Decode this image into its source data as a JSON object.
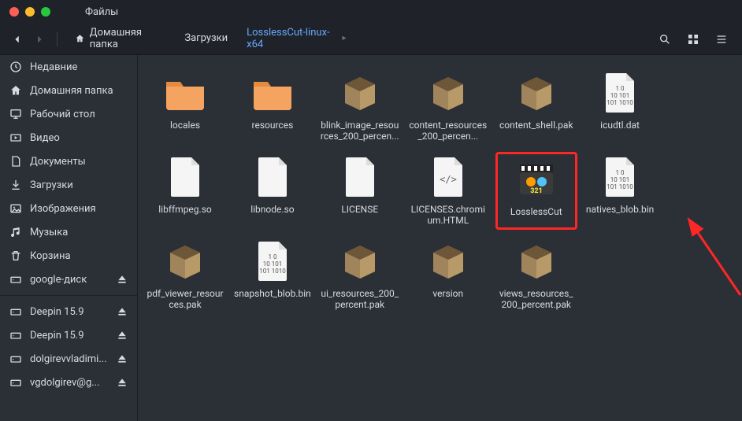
{
  "window": {
    "title": "Файлы"
  },
  "breadcrumb": {
    "home": "Домашняя папка",
    "downloads": "Загрузки",
    "current": "LosslessCut-linux-x64"
  },
  "sidebar": {
    "items": [
      {
        "icon": "clock-icon",
        "label": "Недавние"
      },
      {
        "icon": "home-icon",
        "label": "Домашняя папка"
      },
      {
        "icon": "desktop-icon",
        "label": "Рабочий стол"
      },
      {
        "icon": "video-icon",
        "label": "Видео"
      },
      {
        "icon": "documents-icon",
        "label": "Документы"
      },
      {
        "icon": "downloads-icon",
        "label": "Загрузки"
      },
      {
        "icon": "pictures-icon",
        "label": "Изображения"
      },
      {
        "icon": "music-icon",
        "label": "Музыка"
      },
      {
        "icon": "trash-icon",
        "label": "Корзина"
      },
      {
        "icon": "drive-icon",
        "label": "google-диск",
        "eject": true
      }
    ],
    "mounts": [
      {
        "icon": "drive-icon",
        "label": "Deepin 15.9",
        "eject": true
      },
      {
        "icon": "drive-icon",
        "label": "Deepin 15.9",
        "eject": true
      },
      {
        "icon": "drive-icon",
        "label": "dolgirevvladimi...",
        "eject": true
      },
      {
        "icon": "drive-icon",
        "label": "vgdolgirev@g...",
        "eject": true
      }
    ]
  },
  "files": [
    {
      "name": "locales",
      "type": "folder"
    },
    {
      "name": "resources",
      "type": "folder"
    },
    {
      "name": "blink_image_resources_200_percen...",
      "type": "package"
    },
    {
      "name": "content_resources_200_percen...",
      "type": "package"
    },
    {
      "name": "content_shell.pak",
      "type": "package"
    },
    {
      "name": "icudtl.dat",
      "type": "binary"
    },
    {
      "name": "",
      "type": "empty"
    },
    {
      "name": "libffmpeg.so",
      "type": "file"
    },
    {
      "name": "libnode.so",
      "type": "file"
    },
    {
      "name": "LICENSE",
      "type": "file"
    },
    {
      "name": "LICENSES.chromium.HTML",
      "type": "html"
    },
    {
      "name": "LosslessCut",
      "type": "media",
      "highlight": true
    },
    {
      "name": "natives_blob.bin",
      "type": "binary"
    },
    {
      "name": "",
      "type": "empty"
    },
    {
      "name": "pdf_viewer_resources.pak",
      "type": "package"
    },
    {
      "name": "snapshot_blob.bin",
      "type": "binary"
    },
    {
      "name": "ui_resources_200_percent.pak",
      "type": "package"
    },
    {
      "name": "version",
      "type": "package"
    },
    {
      "name": "views_resources_200_percent.pak",
      "type": "package"
    }
  ]
}
